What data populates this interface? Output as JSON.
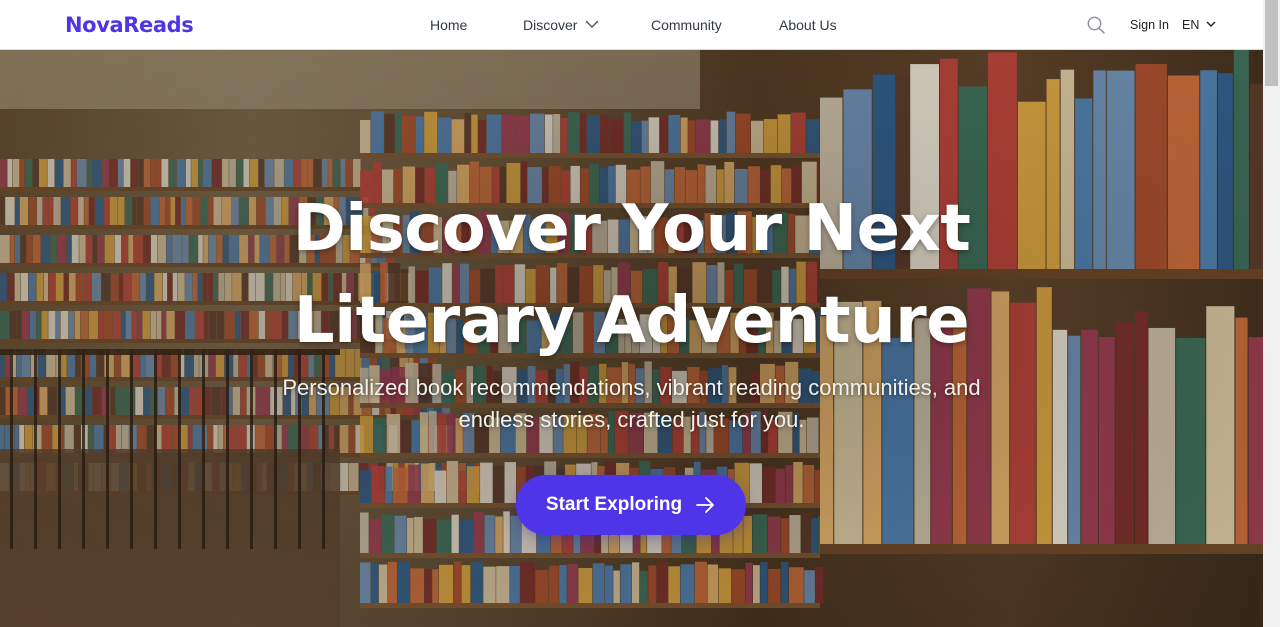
{
  "brand": {
    "name": "NovaReads",
    "accent": "#4f35e8"
  },
  "nav": {
    "items": [
      {
        "label": "Home"
      },
      {
        "label": "Discover",
        "has_dropdown": true
      },
      {
        "label": "Community"
      },
      {
        "label": "About Us"
      }
    ],
    "search_icon": "search-icon",
    "sign_in": "Sign In",
    "language": "EN"
  },
  "hero": {
    "title_line1": "Discover Your Next",
    "title_line2": "Literary Adventure",
    "subtitle_line1": "Personalized book recommendations, vibrant reading communities, and",
    "subtitle_line2": "endless stories, crafted just for you.",
    "cta_label": "Start Exploring",
    "cta_icon": "arrow-right-icon",
    "cta_color": "#4f35e8",
    "background": "library-bookshelves-photo"
  }
}
